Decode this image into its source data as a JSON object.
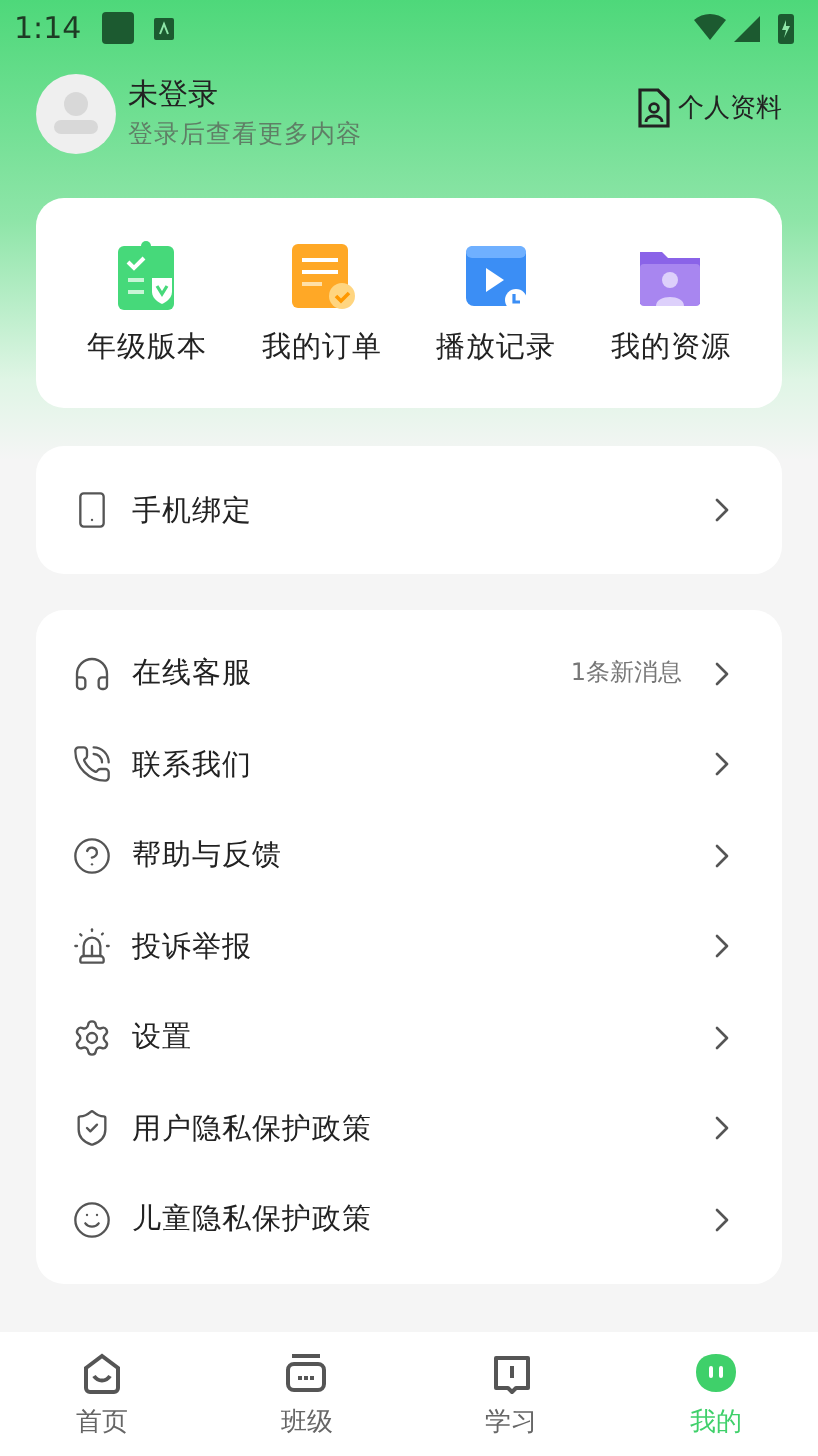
{
  "status_bar": {
    "time": "1:14"
  },
  "profile": {
    "name": "未登录",
    "subtitle": "登录后查看更多内容",
    "link": "个人资料"
  },
  "quick_actions": [
    {
      "kind": "grade",
      "label": "年级版本"
    },
    {
      "kind": "orders",
      "label": "我的订单"
    },
    {
      "kind": "history",
      "label": "播放记录"
    },
    {
      "kind": "resources",
      "label": "我的资源"
    }
  ],
  "phone_binding": {
    "label": "手机绑定"
  },
  "menu": [
    {
      "kind": "headset",
      "label": "在线客服",
      "badge": "1条新消息"
    },
    {
      "kind": "phone",
      "label": "联系我们"
    },
    {
      "kind": "help",
      "label": "帮助与反馈"
    },
    {
      "kind": "alarm",
      "label": "投诉举报"
    },
    {
      "kind": "settings",
      "label": "设置"
    },
    {
      "kind": "shield",
      "label": "用户隐私保护政策"
    },
    {
      "kind": "child",
      "label": "儿童隐私保护政策"
    }
  ],
  "tabs": [
    {
      "kind": "home",
      "label": "首页",
      "selected": false
    },
    {
      "kind": "class",
      "label": "班级",
      "selected": false
    },
    {
      "kind": "study",
      "label": "学习",
      "selected": false
    },
    {
      "kind": "me",
      "label": "我的",
      "selected": true
    }
  ]
}
